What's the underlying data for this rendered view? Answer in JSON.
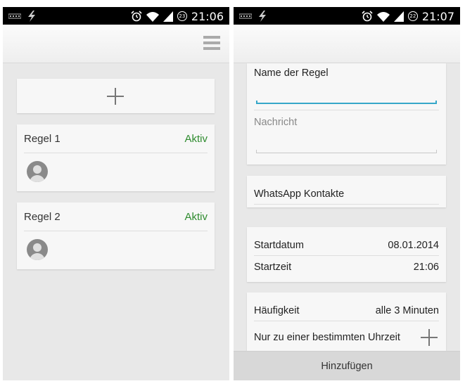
{
  "left_screen": {
    "status_bar": {
      "time": "21:06",
      "notification_badge": "23"
    },
    "rules": [
      {
        "name": "Regel 1",
        "status": "Aktiv"
      },
      {
        "name": "Regel 2",
        "status": "Aktiv"
      }
    ]
  },
  "right_screen": {
    "status_bar": {
      "time": "21:07",
      "notification_badge": "22"
    },
    "form": {
      "name_label": "Name der Regel",
      "name_value": "",
      "message_label": "Nachricht",
      "message_value": ""
    },
    "contacts": {
      "label": "WhatsApp Kontakte"
    },
    "schedule": {
      "start_date_label": "Startdatum",
      "start_date_value": "08.01.2014",
      "start_time_label": "Startzeit",
      "start_time_value": "21:06"
    },
    "frequency": {
      "label": "Häufigkeit",
      "value": "alle 3 Minuten",
      "specific_time_label": "Nur zu einer bestimmten Uhrzeit"
    },
    "submit_label": "Hinzufügen"
  },
  "colors": {
    "accent_blue": "#36a7c9",
    "active_green": "#2e8b2e",
    "background": "#e8e8e8",
    "card": "#f7f7f7"
  }
}
